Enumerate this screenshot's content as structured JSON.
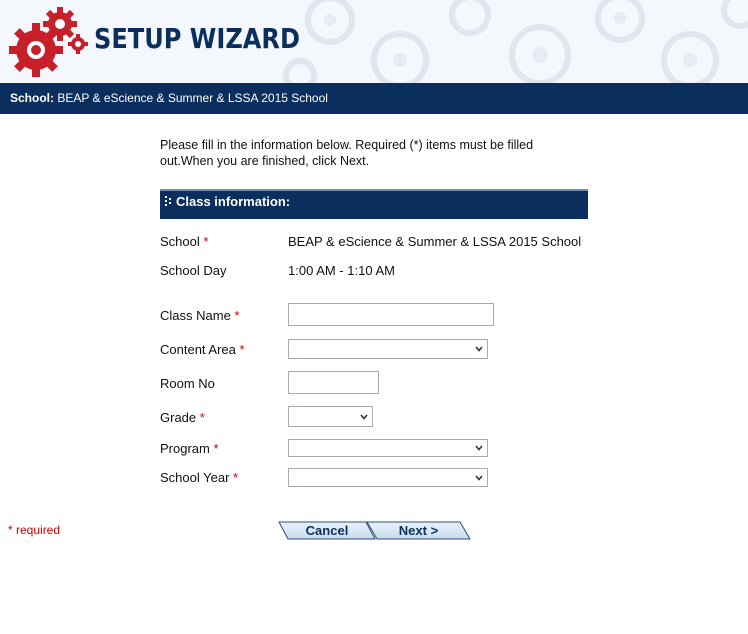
{
  "header": {
    "title": "SETUP WIZARD"
  },
  "school_bar": {
    "label": "School:",
    "name": "BEAP & eScience & Summer & LSSA 2015 School"
  },
  "instructions": "Please fill in the information below. Required (*) items must be filled out.When you are finished, click Next.",
  "section": {
    "title": "Class information:"
  },
  "info": {
    "school_label": "School",
    "school_value": "BEAP & eScience & Summer & LSSA 2015 School",
    "day_label": "School Day",
    "day_value": "1:00 AM - 1:10 AM"
  },
  "form": {
    "required_mark": "*",
    "class_name": {
      "label": "Class Name",
      "value": ""
    },
    "content_area": {
      "label": "Content Area",
      "selected": ""
    },
    "room_no": {
      "label": "Room No",
      "value": ""
    },
    "grade": {
      "label": "Grade",
      "selected": ""
    },
    "program": {
      "label": "Program",
      "selected": ""
    },
    "school_year": {
      "label": "School Year",
      "selected": ""
    }
  },
  "footer": {
    "required_note": "* required"
  },
  "buttons": {
    "cancel": "Cancel",
    "next": "Next >"
  },
  "colors": {
    "brand_navy": "#0a2f5f",
    "gear_red": "#c8202a",
    "required_red": "#cc0000"
  },
  "icons": {
    "logo": "red-gears-icon",
    "section": "dotted-grip-icon",
    "select": "chevron-down-icon"
  }
}
